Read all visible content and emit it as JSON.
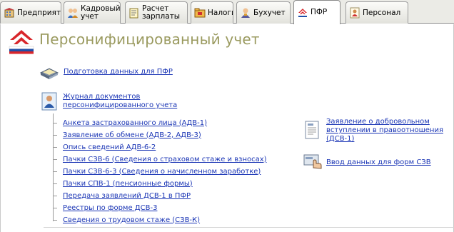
{
  "tabs": [
    {
      "label": "Предприятие",
      "icon": "building-icon",
      "active": false
    },
    {
      "label": "Кадровый\nучет",
      "icon": "people-icon",
      "active": false
    },
    {
      "label": "Расчет\nзарплаты",
      "icon": "payroll-icon",
      "active": false
    },
    {
      "label": "Налоги",
      "icon": "tax-folder-icon",
      "active": false
    },
    {
      "label": "Бухучет",
      "icon": "accountant-icon",
      "active": false
    },
    {
      "label": "ПФР",
      "icon": "pfr-logo-icon",
      "active": true
    },
    {
      "label": "Персонал",
      "icon": "person-icon",
      "active": false
    }
  ],
  "page": {
    "title": "Персонифицированный учет"
  },
  "links": {
    "prepare": "Подготовка данных для ПФР",
    "journal": "Журнал документов\nперсонифицированного учета",
    "application": "Заявление о добровольном\nвступлении в правоотношения\n(ДСВ-1)",
    "input_szv": "Ввод данных для форм СЗВ"
  },
  "sub_links": [
    "Анкета застрахованного лица (АДВ-1)",
    "Заявление об обмене (АДВ-2, АДВ-3)",
    "Опись сведений АДВ-6-2",
    "Пачки СЗВ-6 (Сведения о страховом стаже и взносах)",
    "Пачки СЗВ-6-3 (Сведения о начисленном заработке)",
    "Пачки СПВ-1 (пенсионные формы)",
    "Передача заявлений ДСВ-1 в ПФР",
    "Реестры по форме ДСВ-3",
    "Сведения о трудовом стаже (СЗВ-К)"
  ],
  "colors": {
    "link": "#1a35b5",
    "title": "#9a9a5f",
    "pfr_red": "#d8262b",
    "pfr_blue": "#1f4fa8"
  }
}
